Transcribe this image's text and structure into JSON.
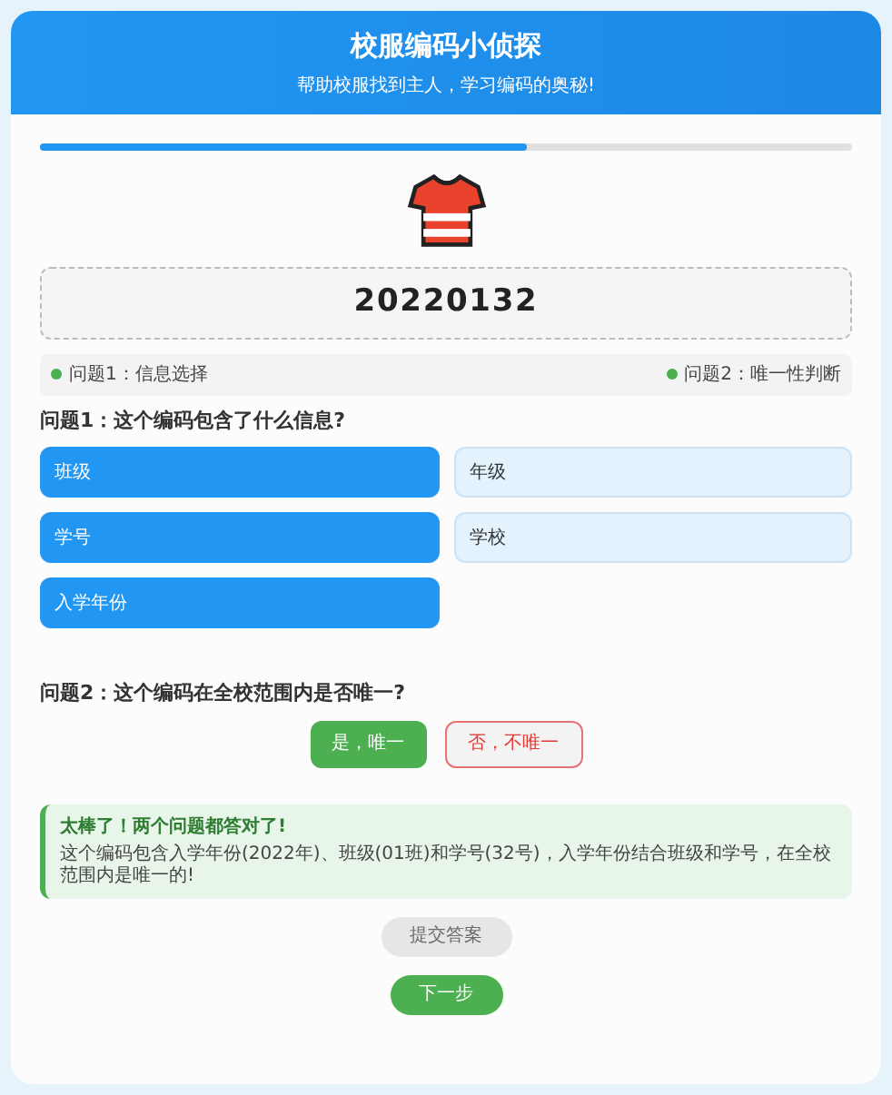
{
  "header": {
    "title": "校服编码小侦探",
    "subtitle": "帮助校服找到主人，学习编码的奥秘!"
  },
  "progress": {
    "level": 0.6
  },
  "code": "20220132",
  "steps": [
    {
      "label": "问题1：信息选择",
      "color": "#4caf50"
    },
    {
      "label": "问题2：唯一性判断",
      "color": "#4caf50"
    }
  ],
  "question1": {
    "title": "问题1：这个编码包含了什么信息?",
    "options": [
      {
        "label": "班级",
        "selected": true
      },
      {
        "label": "年级",
        "selected": false
      },
      {
        "label": "学号",
        "selected": true
      },
      {
        "label": "学校",
        "selected": false
      },
      {
        "label": "入学年份",
        "selected": true
      }
    ]
  },
  "question2": {
    "title": "问题2：这个编码在全校范围内是否唯一?",
    "options": [
      {
        "label": "是，唯一",
        "selected": true
      },
      {
        "label": "否，不唯一",
        "selected": false
      }
    ]
  },
  "feedback": {
    "title": "太棒了！两个问题都答对了!",
    "text": "这个编码包含入学年份(2022年)、班级(01班)和学号(32号)，入学年份结合班级和学号，在全校范围内是唯一的!"
  },
  "submit": {
    "label": "提交答案",
    "disabled": true
  },
  "next": {
    "label": "下一步"
  }
}
